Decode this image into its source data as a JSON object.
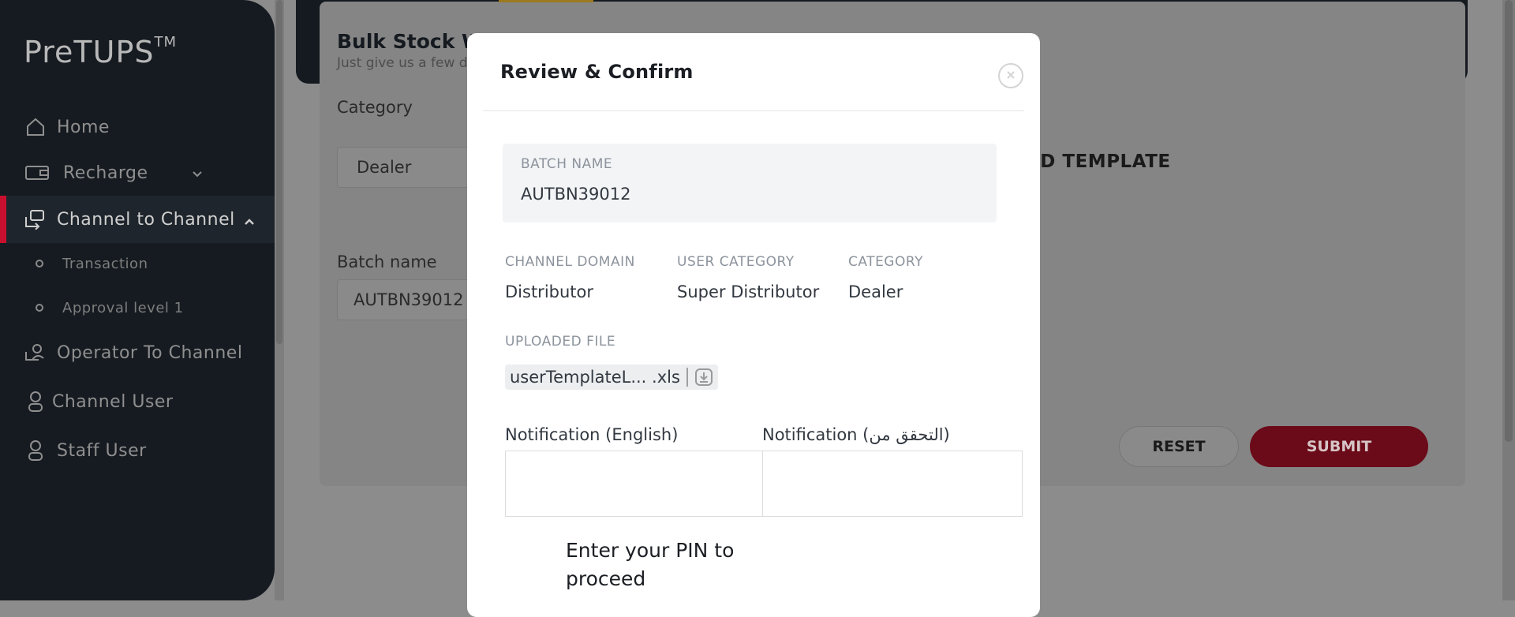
{
  "sidebar": {
    "brand": "PreTUPS",
    "brand_tm": "TM",
    "items": [
      {
        "label": "Home",
        "icon": "home-icon"
      },
      {
        "label": "Recharge",
        "icon": "recharge-icon"
      },
      {
        "label": "Channel to Channel",
        "icon": "channel-transfer-icon"
      },
      {
        "label": "Operator To Channel",
        "icon": "operator-icon"
      },
      {
        "label": "Channel User",
        "icon": "user-icon"
      },
      {
        "label": "Staff User",
        "icon": "user-icon"
      }
    ],
    "sub_items": [
      {
        "label": "Transaction"
      },
      {
        "label": "Approval level 1"
      }
    ]
  },
  "page": {
    "title": "Bulk Stock Wi",
    "subtitle": "Just give us a few d",
    "category_label": "Category",
    "category_value": "Dealer",
    "batch_label": "Batch name",
    "batch_value": "AUTBN39012",
    "template_text": "AD TEMPLATE",
    "reset_label": "RESET",
    "submit_label": "SUBMIT"
  },
  "modal": {
    "title": "Review & Confirm",
    "batch_name_caption": "BATCH NAME",
    "batch_name_value": "AUTBN39012",
    "channel_domain_caption": "CHANNEL DOMAIN",
    "channel_domain_value": "Distributor",
    "user_category_caption": "USER CATEGORY",
    "user_category_value": "Super Distributor",
    "category_caption": "CATEGORY",
    "category_value": "Dealer",
    "uploaded_file_caption": "UPLOADED FILE",
    "uploaded_file_name": "userTemplateL... .xls",
    "notification_en_label": "Notification (English)",
    "notification_ar_label": "Notification (التحقق من)",
    "notification_en_value": "",
    "notification_ar_value": "",
    "pin_prompt": "Enter your PIN to proceed"
  },
  "colors": {
    "accent": "#c8102e",
    "sidebar_bg": "#161b21"
  }
}
